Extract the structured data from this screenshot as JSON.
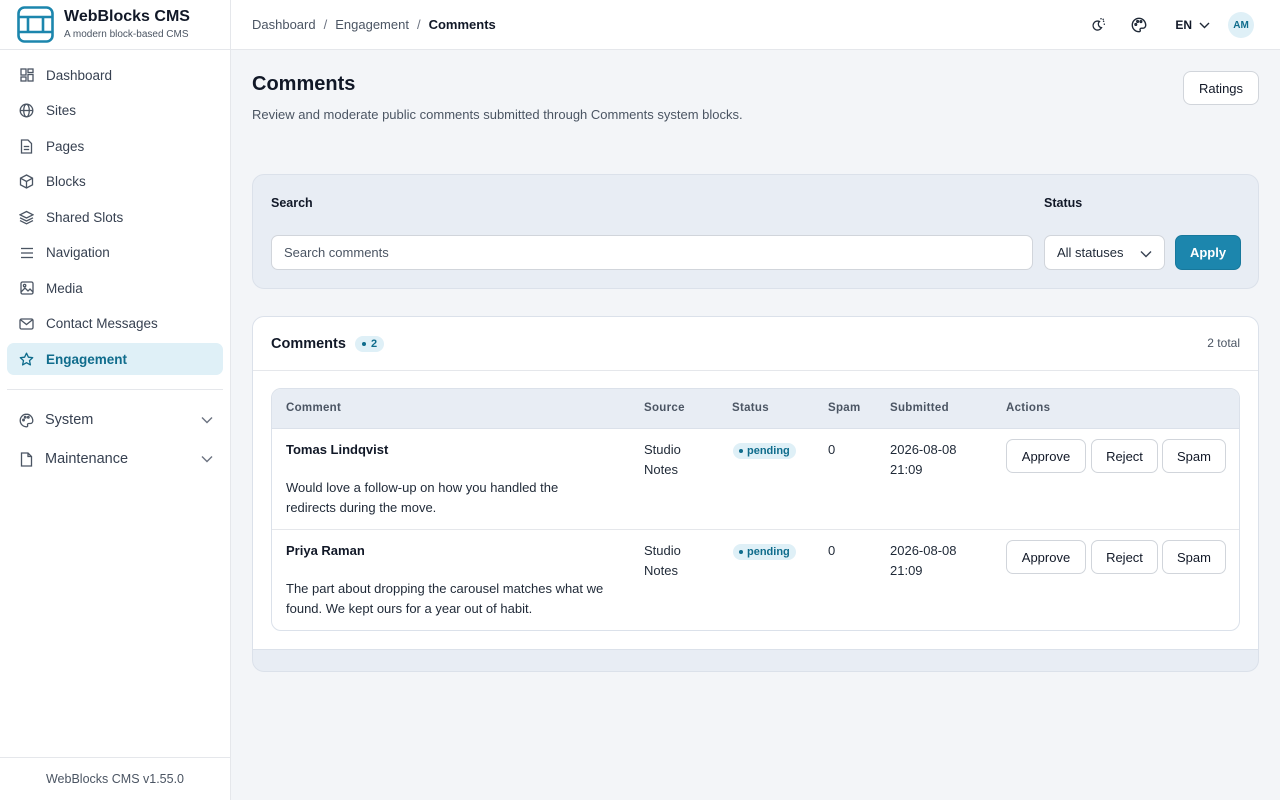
{
  "app": {
    "name": "WebBlocks CMS",
    "tagline": "A modern block-based CMS",
    "version": "WebBlocks CMS v1.55.0"
  },
  "sidebar": {
    "items": [
      {
        "label": "Dashboard",
        "icon": "dashboard-icon"
      },
      {
        "label": "Sites",
        "icon": "globe-icon"
      },
      {
        "label": "Pages",
        "icon": "document-icon"
      },
      {
        "label": "Blocks",
        "icon": "cube-icon"
      },
      {
        "label": "Shared Slots",
        "icon": "layers-icon"
      },
      {
        "label": "Navigation",
        "icon": "menu-icon"
      },
      {
        "label": "Media",
        "icon": "image-icon"
      },
      {
        "label": "Contact Messages",
        "icon": "mail-icon"
      },
      {
        "label": "Engagement",
        "icon": "star-icon",
        "active": true
      }
    ],
    "groups": [
      {
        "label": "System",
        "icon": "palette-icon"
      },
      {
        "label": "Maintenance",
        "icon": "file-icon"
      }
    ]
  },
  "topbar": {
    "breadcrumbs": [
      "Dashboard",
      "Engagement",
      "Comments"
    ],
    "separator": "/",
    "language": "EN",
    "avatar_initials": "AM"
  },
  "page": {
    "title": "Comments",
    "subtitle": "Review and moderate public comments submitted through Comments system blocks.",
    "ratings_button": "Ratings"
  },
  "filters": {
    "search_label": "Search",
    "search_placeholder": "Search comments",
    "search_value": "",
    "status_label": "Status",
    "status_value": "All statuses",
    "apply_label": "Apply"
  },
  "comments": {
    "title": "Comments",
    "badge_count": "2",
    "total_text": "2 total",
    "columns": [
      "Comment",
      "Source",
      "Status",
      "Spam",
      "Submitted",
      "Actions"
    ],
    "rows": [
      {
        "author": "Tomas Lindqvist",
        "body_line1": "Would love a follow-up on how you handled the",
        "body_line2": "redirects during the move.",
        "source_line1": "Studio",
        "source_line2": "Notes",
        "status": "pending",
        "spam": "0",
        "date": "2026-08-08",
        "time": "21:09"
      },
      {
        "author": "Priya Raman",
        "body_line1": "The part about dropping the carousel matches what we",
        "body_line2": "found. We kept ours for a year out of habit.",
        "source_line1": "Studio",
        "source_line2": "Notes",
        "status": "pending",
        "spam": "0",
        "date": "2026-08-08",
        "time": "21:09"
      }
    ],
    "actions": {
      "approve": "Approve",
      "reject": "Reject",
      "spam": "Spam"
    }
  },
  "colors": {
    "accent": "#1c86ad",
    "accent_soft": "#dff0f7",
    "accent_text": "#0f6c8c",
    "page_bg": "#f3f5f8"
  }
}
